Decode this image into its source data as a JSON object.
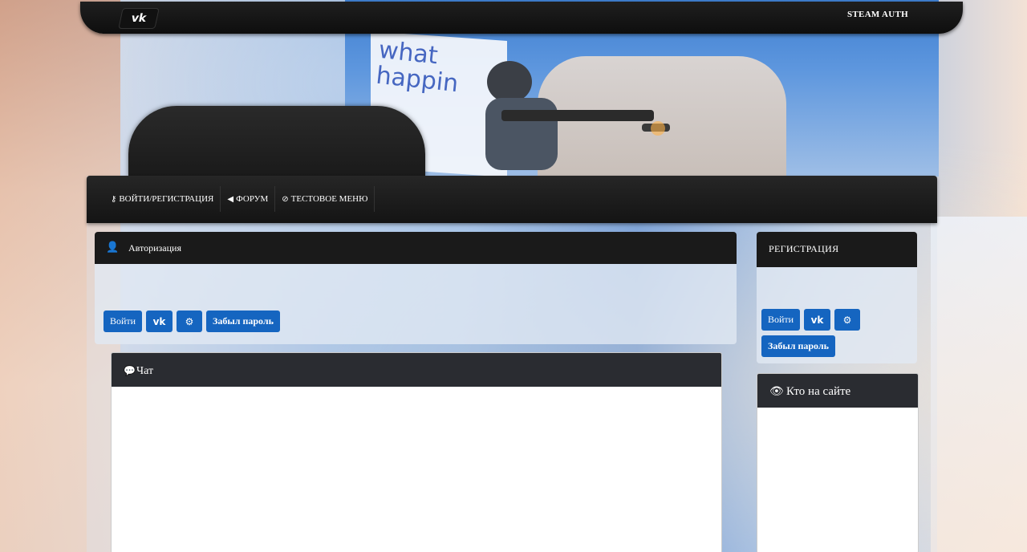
{
  "header": {
    "social_icon": "vk-icon",
    "steam_auth_label": "STEAM AUTH",
    "banner_text": "what happin"
  },
  "nav": {
    "items": [
      {
        "icon": "key-icon",
        "label": "ВОЙТИ/РЕГИСТРАЦИЯ"
      },
      {
        "icon": "megaphone-icon",
        "label": "ФОРУМ"
      },
      {
        "icon": "ban-icon",
        "label": "ТЕСТОВОЕ МЕНЮ"
      }
    ]
  },
  "auth": {
    "title": "Авторизация",
    "login_button": "Войти",
    "vk_button_icon": "vk-icon",
    "steam_button_icon": "steam-icon",
    "forgot_button": "Забыл пароль"
  },
  "register": {
    "title": "РЕГИСТРАЦИЯ",
    "login_button": "Войти",
    "vk_button_icon": "vk-icon",
    "steam_button_icon": "steam-icon",
    "forgot_button": "Забыл пароль"
  },
  "chat": {
    "title": "Чат",
    "icon": "comment-icon"
  },
  "online": {
    "title": "Кто на сайте",
    "icon": "eye-icon"
  }
}
